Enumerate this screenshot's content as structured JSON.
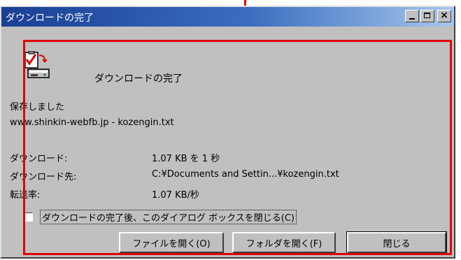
{
  "window": {
    "title": "ダウンロードの完了",
    "buttons": {
      "minimize": "_",
      "maximize": "□",
      "close": "×"
    }
  },
  "header": {
    "heading": "ダウンロードの完了",
    "icon": "download-complete-icon"
  },
  "status": {
    "saved_label": "保存しました",
    "filename": "www.shinkin-webfb.jp - kozengin.txt"
  },
  "details": {
    "download_label": "ダウンロード:",
    "download_value": "1.07 KB を 1 秒",
    "destination_label": "ダウンロード先:",
    "destination_value": "C:¥Documents and Settin...¥kozengin.txt",
    "rate_label": "転送率:",
    "rate_value": "1.07 KB/秒"
  },
  "options": {
    "close_on_complete_label": "ダウンロードの完了後、このダイアログ ボックスを閉じる(C)",
    "close_on_complete_checked": false
  },
  "actions": {
    "open_file": "ファイルを開く(O)",
    "open_folder": "フォルダを開く(F)",
    "close": "閉じる"
  },
  "annotation": {
    "color": "#e00000"
  },
  "colors": {
    "titlebar_start": "#1a3f93",
    "titlebar_end": "#a7c7ec",
    "face": "#c0c0c0"
  }
}
